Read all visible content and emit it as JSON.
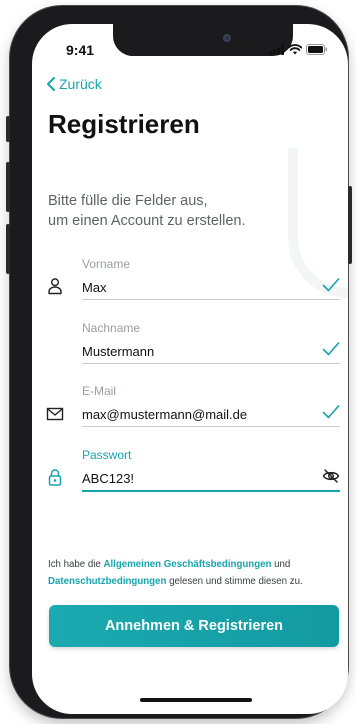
{
  "status_bar": {
    "time": "9:41"
  },
  "nav": {
    "back_label": "Zurück"
  },
  "page": {
    "title": "Registrieren",
    "subtitle_line1": "Bitte fülle die Felder aus,",
    "subtitle_line2": "um einen Account zu erstellen."
  },
  "form": {
    "first_name": {
      "label": "Vorname",
      "value": "Max",
      "valid": true
    },
    "last_name": {
      "label": "Nachname",
      "value": "Mustermann",
      "valid": true
    },
    "email": {
      "label": "E-Mail",
      "value": "max@mustermann@mail.de",
      "valid": true
    },
    "password": {
      "label": "Passwort",
      "value": "ABC123!",
      "focused": true
    }
  },
  "terms": {
    "prefix": "Ich habe die ",
    "agb_link": "Allgemeinen Geschäftsbedingungen",
    "middle": " und",
    "privacy_link": "Datenschutzbedingungen",
    "suffix": " gelesen und stimme diesen zu."
  },
  "actions": {
    "submit_label": "Annehmen & Registrieren"
  },
  "colors": {
    "accent": "#17a5ad",
    "text": "#111111",
    "muted": "#9a9fa3"
  },
  "icons": [
    "back-chevron-icon",
    "person-icon",
    "envelope-icon",
    "lock-icon",
    "check-icon",
    "eye-slash-icon",
    "signal-icon",
    "wifi-icon",
    "battery-icon"
  ]
}
